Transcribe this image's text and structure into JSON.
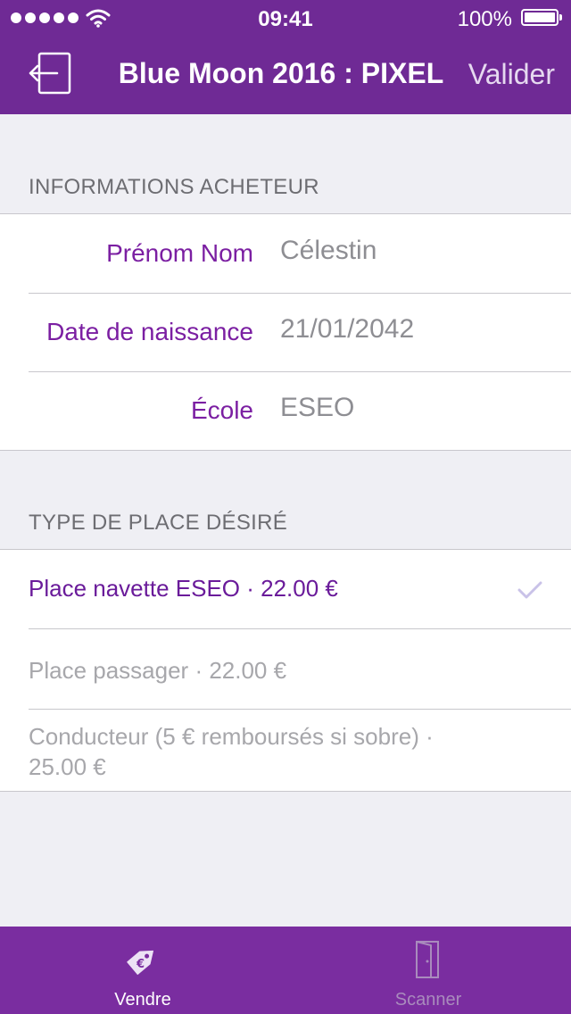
{
  "status_bar": {
    "time": "09:41",
    "battery": "100%"
  },
  "nav": {
    "title": "Blue Moon 2016 : PIXEL",
    "action": "Valider"
  },
  "buyer_section": {
    "header": "INFORMATIONS ACHETEUR",
    "fields": [
      {
        "label": "Prénom Nom",
        "value": "Célestin"
      },
      {
        "label": "Date de naissance",
        "value": "21/01/2042"
      },
      {
        "label": "École",
        "value": "ESEO"
      }
    ]
  },
  "ticket_section": {
    "header": "TYPE DE PLACE DÉSIRÉ",
    "options": [
      {
        "label": "Place navette ESEO · 22.00 €",
        "selected": true
      },
      {
        "label": "Place passager · 22.00 €",
        "selected": false
      },
      {
        "label": "Conducteur (5 € remboursés si sobre) · 25.00 €",
        "selected": false
      }
    ]
  },
  "tabbar": {
    "tabs": [
      {
        "label": "Vendre",
        "icon": "price-tag-icon",
        "active": true
      },
      {
        "label": "Scanner",
        "icon": "door-icon",
        "active": false
      }
    ]
  },
  "colors": {
    "primary": "#6f2a95",
    "tabbar": "#7a2da0",
    "label": "#7b1fa2",
    "value": "#8e8e93",
    "disabled": "#a7a7ab",
    "background": "#efeff4"
  }
}
